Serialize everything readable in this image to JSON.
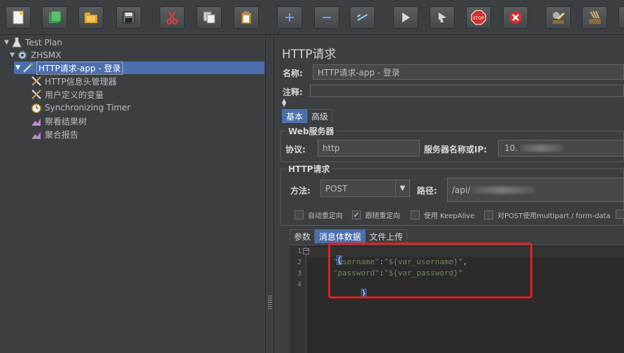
{
  "toolbar": {
    "buttons": [
      "new-icon",
      "templates-icon",
      "open-icon",
      "save-icon",
      "cut-icon",
      "copy-icon",
      "paste-icon",
      "expand-icon",
      "collapse-icon",
      "toggle-icon",
      "start-icon",
      "start-no-pause-icon",
      "stop-icon",
      "shutdown-icon",
      "clear-icon",
      "clear-all-icon"
    ]
  },
  "tree": {
    "items": [
      {
        "label": "Test Plan"
      },
      {
        "label": "ZHSMX"
      },
      {
        "label": "HTTP请求-app - 登录"
      },
      {
        "label": "HTTP信息头管理器"
      },
      {
        "label": "用户定义的变量"
      },
      {
        "label": "Synchronizing Timer"
      },
      {
        "label": "察看结果树"
      },
      {
        "label": "聚合报告"
      }
    ]
  },
  "panel": {
    "title": "HTTP请求",
    "name_label": "名称:",
    "name_value": "HTTP请求-app - 登录",
    "comment_label": "注释:",
    "tabs": [
      "基本",
      "高级"
    ],
    "web_server_title": "Web服务器",
    "protocol_label": "协议:",
    "protocol_value": "http",
    "server_label": "服务器名称或IP:",
    "server_value": "10.",
    "http_request_title": "HTTP请求",
    "method_label": "方法:",
    "method_value": "POST",
    "path_label": "路径:",
    "path_value": "/api/",
    "checkboxes": [
      {
        "label": "自动重定向",
        "checked": false
      },
      {
        "label": "跟随重定向",
        "checked": true
      },
      {
        "label": "使用 KeepAlive",
        "checked": false
      },
      {
        "label": "对POST使用multipart / form-data",
        "checked": false
      }
    ],
    "body_tabs": [
      "参数",
      "消息体数据",
      "文件上传"
    ],
    "code": {
      "line_numbers": [
        "1",
        "2",
        "3",
        "4"
      ],
      "open_brace": "{",
      "line2_key": "\"username\"",
      "line2_sep": ":",
      "line2_val": "\"${var_username}\"",
      "line2_end": ",",
      "line3_key": "\"password\"",
      "line3_sep": ":",
      "line3_val": "\"${var_password}\"",
      "close_brace": "}"
    }
  },
  "colors": {
    "selection": "#4b6eaf",
    "background": "#3c3f41",
    "highlight_box": "#e02020"
  }
}
